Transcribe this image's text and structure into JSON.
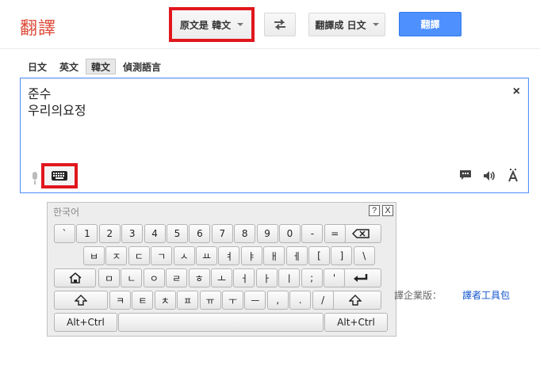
{
  "header": {
    "logo": "翻譯",
    "source_language_button": "原文是 韓文",
    "target_language_button": "翻譯成 日文",
    "translate_button": "翻譯",
    "swap_icon": "swap-arrows-icon"
  },
  "tabs": [
    {
      "label": "日文",
      "active": false
    },
    {
      "label": "英文",
      "active": false
    },
    {
      "label": "韓文",
      "active": true
    },
    {
      "label": "偵測語言",
      "active": false
    }
  ],
  "source": {
    "text": "준수\n우리의요정",
    "clear_label": "×",
    "icons": [
      "microphone-icon",
      "keyboard-icon",
      "chat-icon",
      "speaker-icon",
      "font-icon"
    ]
  },
  "keyboard": {
    "title": "한국어",
    "help_label": "?",
    "close_label": "X",
    "rows": [
      [
        "`",
        "1",
        "2",
        "3",
        "4",
        "5",
        "6",
        "7",
        "8",
        "9",
        "0",
        "-",
        "="
      ],
      [
        "ㅂ",
        "ㅈ",
        "ㄷ",
        "ㄱ",
        "ㅅ",
        "ㅛ",
        "ㅕ",
        "ㅑ",
        "ㅐ",
        "ㅔ",
        "[",
        "]",
        "\\"
      ],
      [
        "ㅁ",
        "ㄴ",
        "ㅇ",
        "ㄹ",
        "ㅎ",
        "ㅗ",
        "ㅓ",
        "ㅏ",
        "ㅣ",
        ";",
        "'"
      ],
      [
        "ㅋ",
        "ㅌ",
        "ㅊ",
        "ㅍ",
        "ㅠ",
        "ㅜ",
        "ㅡ",
        ",",
        ".",
        "/"
      ]
    ],
    "alt_ctrl_left": "Alt+Ctrl",
    "alt_ctrl_right": "Alt+Ctrl",
    "backspace_glyph": "⌫",
    "enter_glyph": "↵",
    "shift_glyph": "⇧",
    "home_glyph": "⌂"
  },
  "footer": {
    "partial_text": "譯企業版：",
    "link": "譯者工具包"
  },
  "colors": {
    "accent_blue": "#4d90fe",
    "highlight_red": "#e0171d",
    "logo_red": "#dd4b39"
  }
}
